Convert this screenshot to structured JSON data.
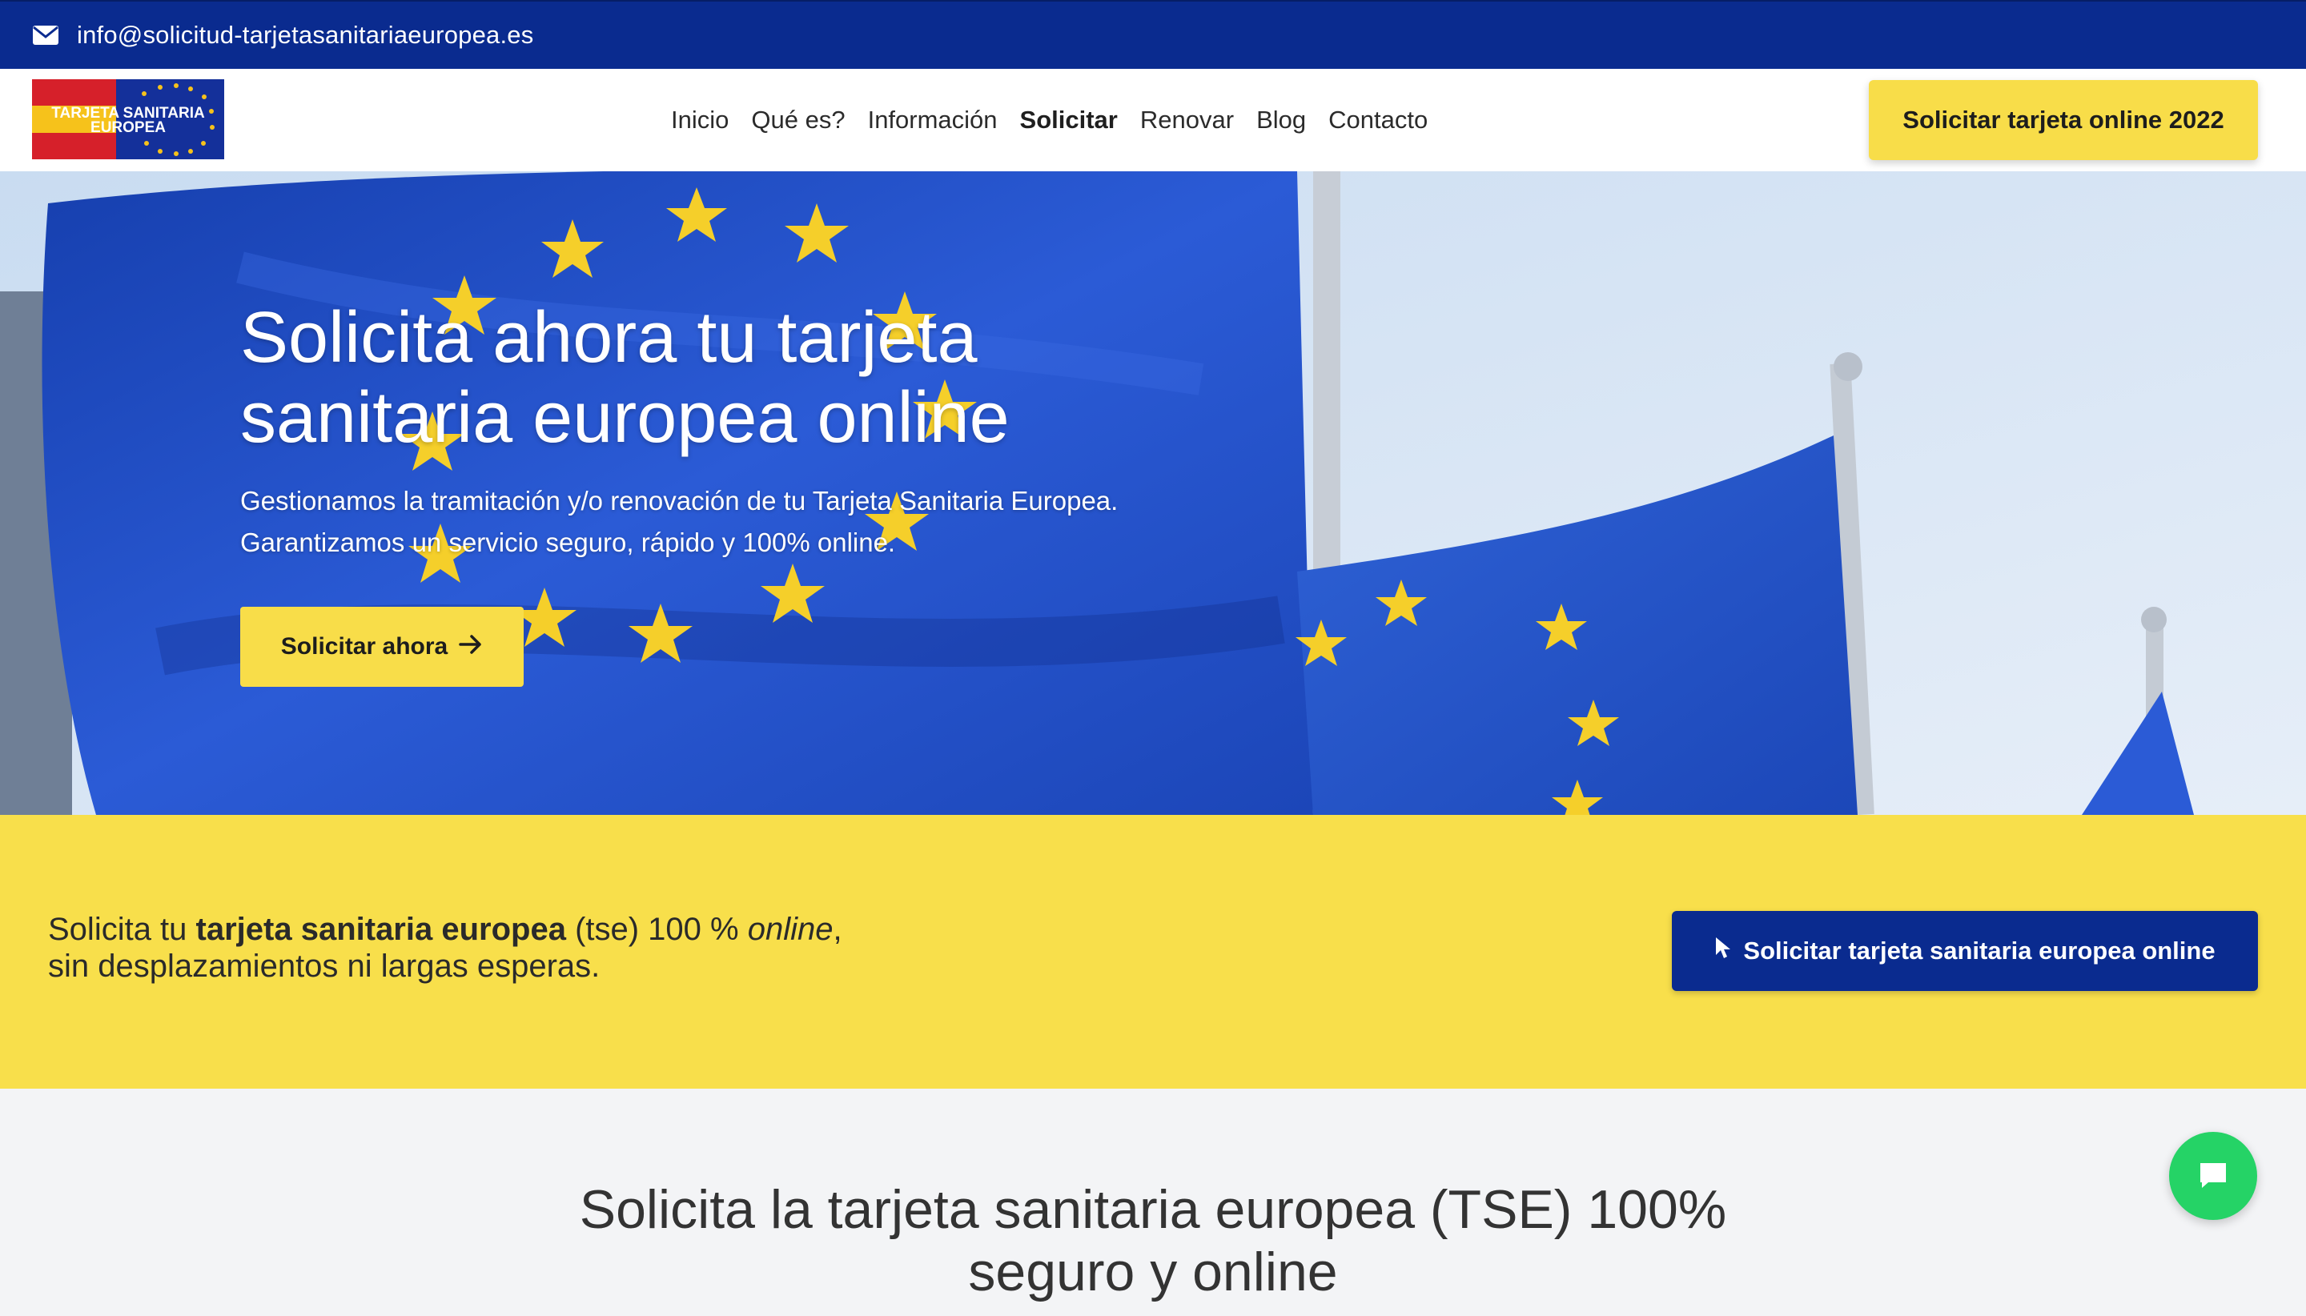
{
  "topbar": {
    "email": "info@solicitud-tarjetasanitariaeuropea.es",
    "icon": "envelope-icon"
  },
  "logo": {
    "line1": "TARJETA SANITARIA",
    "line2": "EUROPEA",
    "colors": {
      "red": "#d6202a",
      "yellow": "#f6c21b",
      "blue": "#14309a"
    }
  },
  "nav": {
    "items": [
      {
        "label": "Inicio"
      },
      {
        "label": "Qué es?"
      },
      {
        "label": "Información"
      },
      {
        "label": "Solicitar",
        "active": true
      },
      {
        "label": "Renovar"
      },
      {
        "label": "Blog"
      },
      {
        "label": "Contacto"
      }
    ],
    "cta_label": "Solicitar tarjeta online 2022"
  },
  "hero": {
    "title": "Solicita ahora tu tarjeta sanitaria europea online",
    "subtitle": "Gestionamos la tramitación y/o renovación de tu Tarjeta Sanitaria Europea. Garantizamos un servicio seguro, rápido y 100% online.",
    "button_label": "Solicitar ahora",
    "button_icon": "arrow-right-icon"
  },
  "band": {
    "text_prefix": "Solicita tu ",
    "text_bold": "tarjeta sanitaria europea",
    "text_mid": " (tse) 100 % ",
    "text_italic": "online",
    "text_suffix": ",",
    "text_line2": "sin desplazamientos ni largas esperas.",
    "button_label": "Solicitar tarjeta sanitaria europea online",
    "button_icon": "cursor-pointer-icon"
  },
  "section": {
    "title": "Solicita la tarjeta sanitaria europea (TSE) 100% seguro y online"
  },
  "chat": {
    "icon": "chat-bubble-icon"
  },
  "colors": {
    "primary_blue": "#0a2b8f",
    "accent_yellow": "#f8dd49",
    "chat_green": "#25d366"
  }
}
